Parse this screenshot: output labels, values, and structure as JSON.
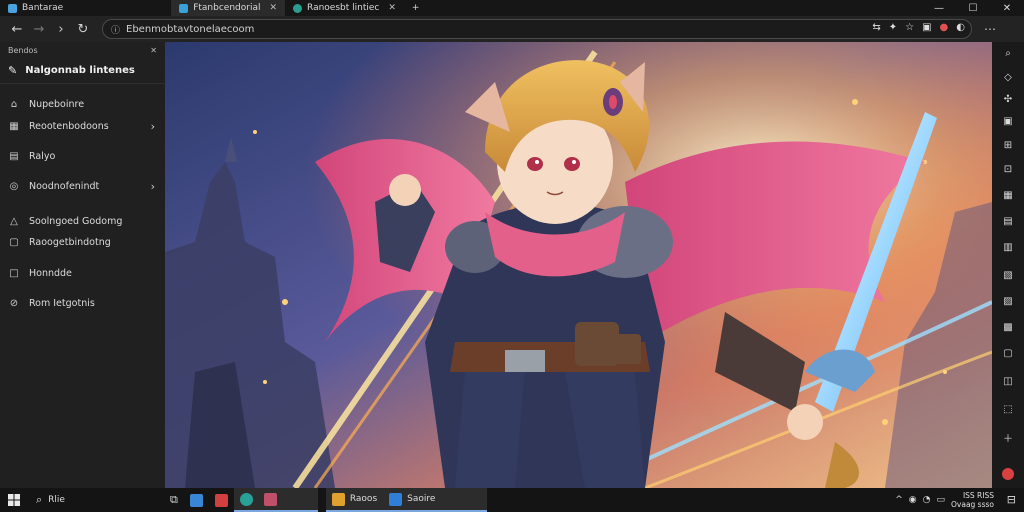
{
  "tabs": [
    {
      "label": "Bantarae",
      "favicon_color": "#4aa3df",
      "active": false
    },
    {
      "label": "Ftanbcendorial",
      "favicon_color": "#3aa0d8",
      "active": true
    },
    {
      "label": "Ranoesbt lintiec",
      "favicon_color": "#2a9d8f",
      "active": false
    }
  ],
  "window_controls": {
    "minimize": "—",
    "maximize": "☐",
    "close": "✕"
  },
  "address": {
    "url": "Ebenmobtavtonelaecoom"
  },
  "sidebar": {
    "header": "Bendos",
    "close": "✕",
    "title": "Nalgonnab lintenes",
    "items": [
      {
        "label": "Nupeboinre",
        "icon": "tag-icon",
        "glyph": "⌂",
        "chevron": false
      },
      {
        "label": "Reootenbodoons",
        "icon": "grid-icon",
        "glyph": "▦",
        "chevron": true
      },
      {
        "label": "Ralyo",
        "icon": "doc-icon",
        "glyph": "▤",
        "chevron": false
      },
      {
        "label": "Noodnofenindt",
        "icon": "settings-icon",
        "glyph": "◎",
        "chevron": true
      },
      {
        "label": "Soolngoed Godomg",
        "icon": "warning-icon",
        "glyph": "△",
        "chevron": false
      },
      {
        "label": "Raoogetbindotng",
        "icon": "box-icon",
        "glyph": "▢",
        "chevron": false
      },
      {
        "label": "Honndde",
        "icon": "square-icon",
        "glyph": "□",
        "chevron": false
      },
      {
        "label": "Rom Ietgotnis",
        "icon": "link-icon",
        "glyph": "⊘",
        "chevron": false
      }
    ]
  },
  "taskbar": {
    "search_label": "Rlie",
    "apps": [
      {
        "label": "",
        "color": "#3a86d6"
      },
      {
        "label": "",
        "color": "#d04040"
      },
      {
        "label": "",
        "color": "#2aa198"
      },
      {
        "label": "",
        "color": "#c0506a"
      },
      {
        "label": "Raoos",
        "color": "#e0a030"
      },
      {
        "label": "Saoire",
        "color": "#2f7fd6"
      }
    ],
    "clock_line1": "ISS RISS",
    "clock_line2": "Ovaag ssso"
  }
}
